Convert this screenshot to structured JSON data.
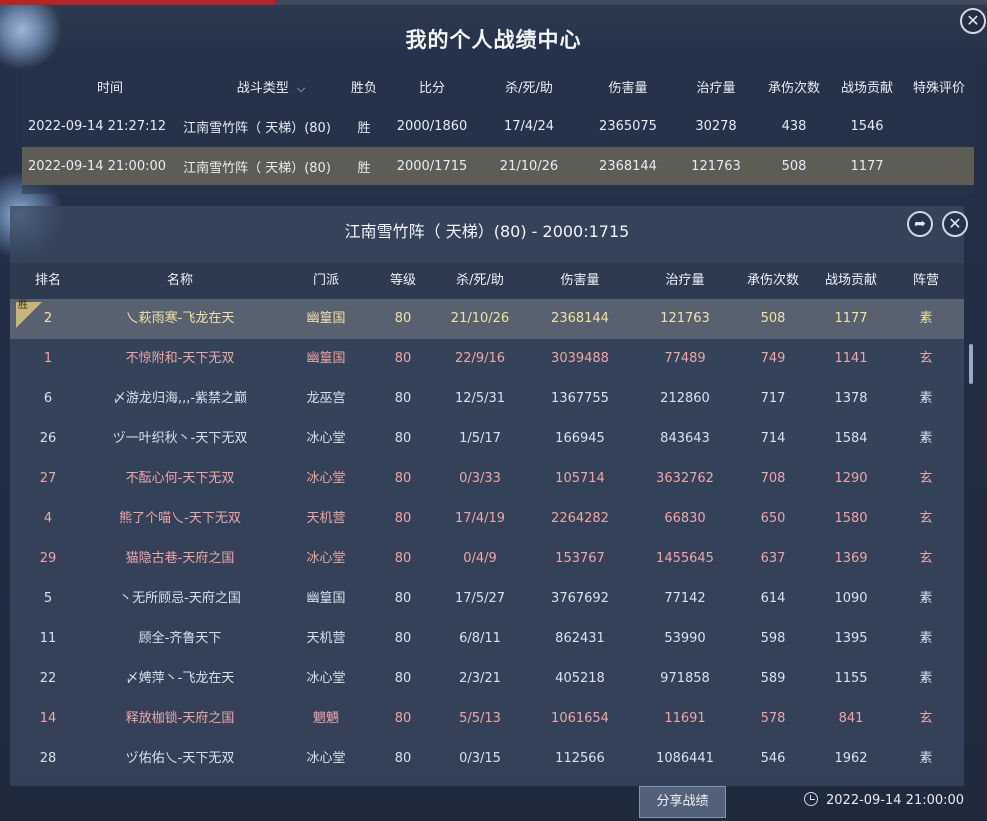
{
  "window": {
    "title": "我的个人战绩中心",
    "close_icon": "close-icon"
  },
  "history": {
    "headers": {
      "time": "时间",
      "type": "战斗类型",
      "result": "胜负",
      "score": "比分",
      "kda": "杀/死/助",
      "damage": "伤害量",
      "heal": "治疗量",
      "taken": "承伤次数",
      "contrib": "战场贡献",
      "special": "特殊评价"
    },
    "type_filter_icon": "chevron-down-icon",
    "rows": [
      {
        "time": "2022-09-14 21:27:12",
        "type": "江南雪竹阵（ 天梯）(80)",
        "result": "胜",
        "score": "2000/1860",
        "kda": "17/4/24",
        "damage": "2365075",
        "heal": "30278",
        "taken": "438",
        "contrib": "1546",
        "special": ""
      },
      {
        "time": "2022-09-14 21:00:00",
        "type": "江南雪竹阵（ 天梯）(80)",
        "result": "胜",
        "score": "2000/1715",
        "kda": "21/10/26",
        "damage": "2368144",
        "heal": "121763",
        "taken": "508",
        "contrib": "1177",
        "special": ""
      }
    ]
  },
  "detail": {
    "title": "江南雪竹阵（ 天梯）(80) - 2000:1715",
    "share_icon": "share-icon",
    "close_icon": "close-icon",
    "headers": {
      "rank": "排名",
      "name": "名称",
      "school": "门派",
      "level": "等级",
      "kda": "杀/死/助",
      "damage": "伤害量",
      "heal": "治疗量",
      "taken": "承伤次数",
      "contrib": "战场贡献",
      "camp": "阵营"
    },
    "win_badge": "胜",
    "rows": [
      {
        "rank": "2",
        "name": "乀萩雨寒-飞龙在天",
        "school": "幽篁国",
        "level": "80",
        "kda": "21/10/26",
        "damage": "2368144",
        "heal": "121763",
        "taken": "508",
        "contrib": "1177",
        "camp": "素"
      },
      {
        "rank": "1",
        "name": "不惊附和-天下无双",
        "school": "幽篁国",
        "level": "80",
        "kda": "22/9/16",
        "damage": "3039488",
        "heal": "77489",
        "taken": "749",
        "contrib": "1141",
        "camp": "玄"
      },
      {
        "rank": "6",
        "name": "〆游龙归海,,,-紫禁之巅",
        "school": "龙巫宫",
        "level": "80",
        "kda": "12/5/31",
        "damage": "1367755",
        "heal": "212860",
        "taken": "717",
        "contrib": "1378",
        "camp": "素"
      },
      {
        "rank": "26",
        "name": "ヅ一叶织秋丶-天下无双",
        "school": "冰心堂",
        "level": "80",
        "kda": "1/5/17",
        "damage": "166945",
        "heal": "843643",
        "taken": "714",
        "contrib": "1584",
        "camp": "素"
      },
      {
        "rank": "27",
        "name": "不酝心何-天下无双",
        "school": "冰心堂",
        "level": "80",
        "kda": "0/3/33",
        "damage": "105714",
        "heal": "3632762",
        "taken": "708",
        "contrib": "1290",
        "camp": "玄"
      },
      {
        "rank": "4",
        "name": "熊了个喵乀-天下无双",
        "school": "天机营",
        "level": "80",
        "kda": "17/4/19",
        "damage": "2264282",
        "heal": "66830",
        "taken": "650",
        "contrib": "1580",
        "camp": "玄"
      },
      {
        "rank": "29",
        "name": "猫隐古巷-天府之国",
        "school": "冰心堂",
        "level": "80",
        "kda": "0/4/9",
        "damage": "153767",
        "heal": "1455645",
        "taken": "637",
        "contrib": "1369",
        "camp": "玄"
      },
      {
        "rank": "5",
        "name": "丶无所顾忌-天府之国",
        "school": "幽篁国",
        "level": "80",
        "kda": "17/5/27",
        "damage": "3767692",
        "heal": "77142",
        "taken": "614",
        "contrib": "1090",
        "camp": "素"
      },
      {
        "rank": "11",
        "name": "顾全-齐鲁天下",
        "school": "天机营",
        "level": "80",
        "kda": "6/8/11",
        "damage": "862431",
        "heal": "53990",
        "taken": "598",
        "contrib": "1395",
        "camp": "素"
      },
      {
        "rank": "22",
        "name": "〆娉萍丶-飞龙在天",
        "school": "冰心堂",
        "level": "80",
        "kda": "2/3/21",
        "damage": "405218",
        "heal": "971858",
        "taken": "589",
        "contrib": "1155",
        "camp": "素"
      },
      {
        "rank": "14",
        "name": "释放枷锁-天府之国",
        "school": "魍魉",
        "level": "80",
        "kda": "5/5/13",
        "damage": "1061654",
        "heal": "11691",
        "taken": "578",
        "contrib": "841",
        "camp": "玄"
      },
      {
        "rank": "28",
        "name": "ヅ佑佑乀-天下无双",
        "school": "冰心堂",
        "level": "80",
        "kda": "0/3/15",
        "damage": "112566",
        "heal": "1086441",
        "taken": "546",
        "contrib": "1962",
        "camp": "素"
      }
    ]
  },
  "footer": {
    "share_label": "分享战绩",
    "time": "2022-09-14 21:00:00",
    "clock_icon": "clock-icon"
  },
  "colors": {
    "selected_text": "#f4e2a3",
    "xuan_text": "#f0a6a6",
    "su_text": "#d9e1ee",
    "selected_row": "#586170",
    "history_selected_row": "#5e5d55"
  }
}
